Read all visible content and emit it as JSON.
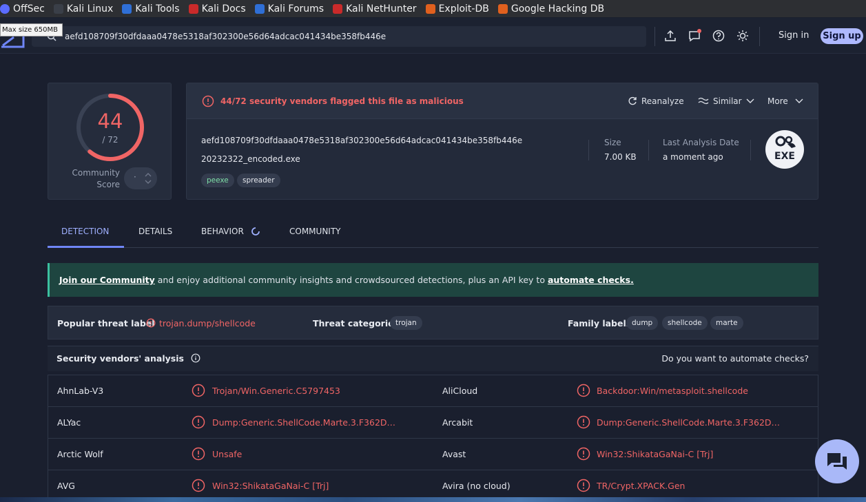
{
  "bookmarks": [
    {
      "label": "OffSec",
      "icon": "offsec-icon",
      "color": "#5b6cff"
    },
    {
      "label": "Kali Linux",
      "icon": "kali-dragon-icon",
      "color": "#3a3f48"
    },
    {
      "label": "Kali Tools",
      "icon": "kali-tools-icon",
      "color": "#2f6fd6"
    },
    {
      "label": "Kali Docs",
      "icon": "kali-docs-icon",
      "color": "#c92a2a"
    },
    {
      "label": "Kali Forums",
      "icon": "kali-forums-icon",
      "color": "#2f6fd6"
    },
    {
      "label": "Kali NetHunter",
      "icon": "nethunter-icon",
      "color": "#c92a2a"
    },
    {
      "label": "Exploit-DB",
      "icon": "exploitdb-icon",
      "color": "#e0601e"
    },
    {
      "label": "Google Hacking DB",
      "icon": "ghdb-icon",
      "color": "#e0601e"
    }
  ],
  "tooltip": "Max size 650MB",
  "search": {
    "value": "aefd108709f30dfdaaa0478e5318af302300e56d64adcac041434be358fb446e"
  },
  "header": {
    "signin": "Sign in",
    "signup": "Sign up"
  },
  "score": {
    "detections": "44",
    "total": "/ 72",
    "fraction": 0.611,
    "community_label_1": "Community",
    "community_label_2": "Score",
    "community_value": "·"
  },
  "summary": {
    "flag_text": "44/72 security vendors flagged this file as malicious",
    "reanalyze": "Reanalyze",
    "similar": "Similar",
    "more": "More",
    "hash": "aefd108709f30dfdaaa0478e5318af302300e56d64adcac041434be358fb446e",
    "filename": "20232322_encoded.exe",
    "tags": [
      "peexe",
      "spreader"
    ],
    "size_label": "Size",
    "size_value": "7.00 KB",
    "date_label": "Last Analysis Date",
    "date_value": "a moment ago",
    "file_type": "EXE"
  },
  "tabs": [
    "DETECTION",
    "DETAILS",
    "BEHAVIOR",
    "COMMUNITY"
  ],
  "banner": {
    "link1": "Join our Community",
    "middle": " and enjoy additional community insights and crowdsourced detections, plus an API key to ",
    "link2": "automate checks."
  },
  "threat": {
    "popular_label": "Popular threat label",
    "popular_value": "trojan.dump/shellcode",
    "categories_label": "Threat categories",
    "categories": [
      "trojan"
    ],
    "family_label": "Family labels",
    "families": [
      "dump",
      "shellcode",
      "marte"
    ]
  },
  "vendors_header": {
    "title": "Security vendors' analysis",
    "automate": "Do you want to automate checks?"
  },
  "vendors": [
    {
      "left_name": "AhnLab-V3",
      "left_result": "Trojan/Win.Generic.C5797453",
      "right_name": "AliCloud",
      "right_result": "Backdoor:Win/metasploit.shellcode"
    },
    {
      "left_name": "ALYac",
      "left_result": "Dump:Generic.ShellCode.Marte.3.F362D…",
      "right_name": "Arcabit",
      "right_result": "Dump:Generic.ShellCode.Marte.3.F362D…"
    },
    {
      "left_name": "Arctic Wolf",
      "left_result": "Unsafe",
      "right_name": "Avast",
      "right_result": "Win32:ShikataGaNai-C [Trj]"
    },
    {
      "left_name": "AVG",
      "left_result": "Win32:ShikataGaNai-C [Trj]",
      "right_name": "Avira (no cloud)",
      "right_result": "TR/Crypt.XPACK.Gen"
    }
  ],
  "colors": {
    "malicious": "#f06565",
    "accent": "#6f86f7",
    "banner_bg": "#1e4540"
  }
}
